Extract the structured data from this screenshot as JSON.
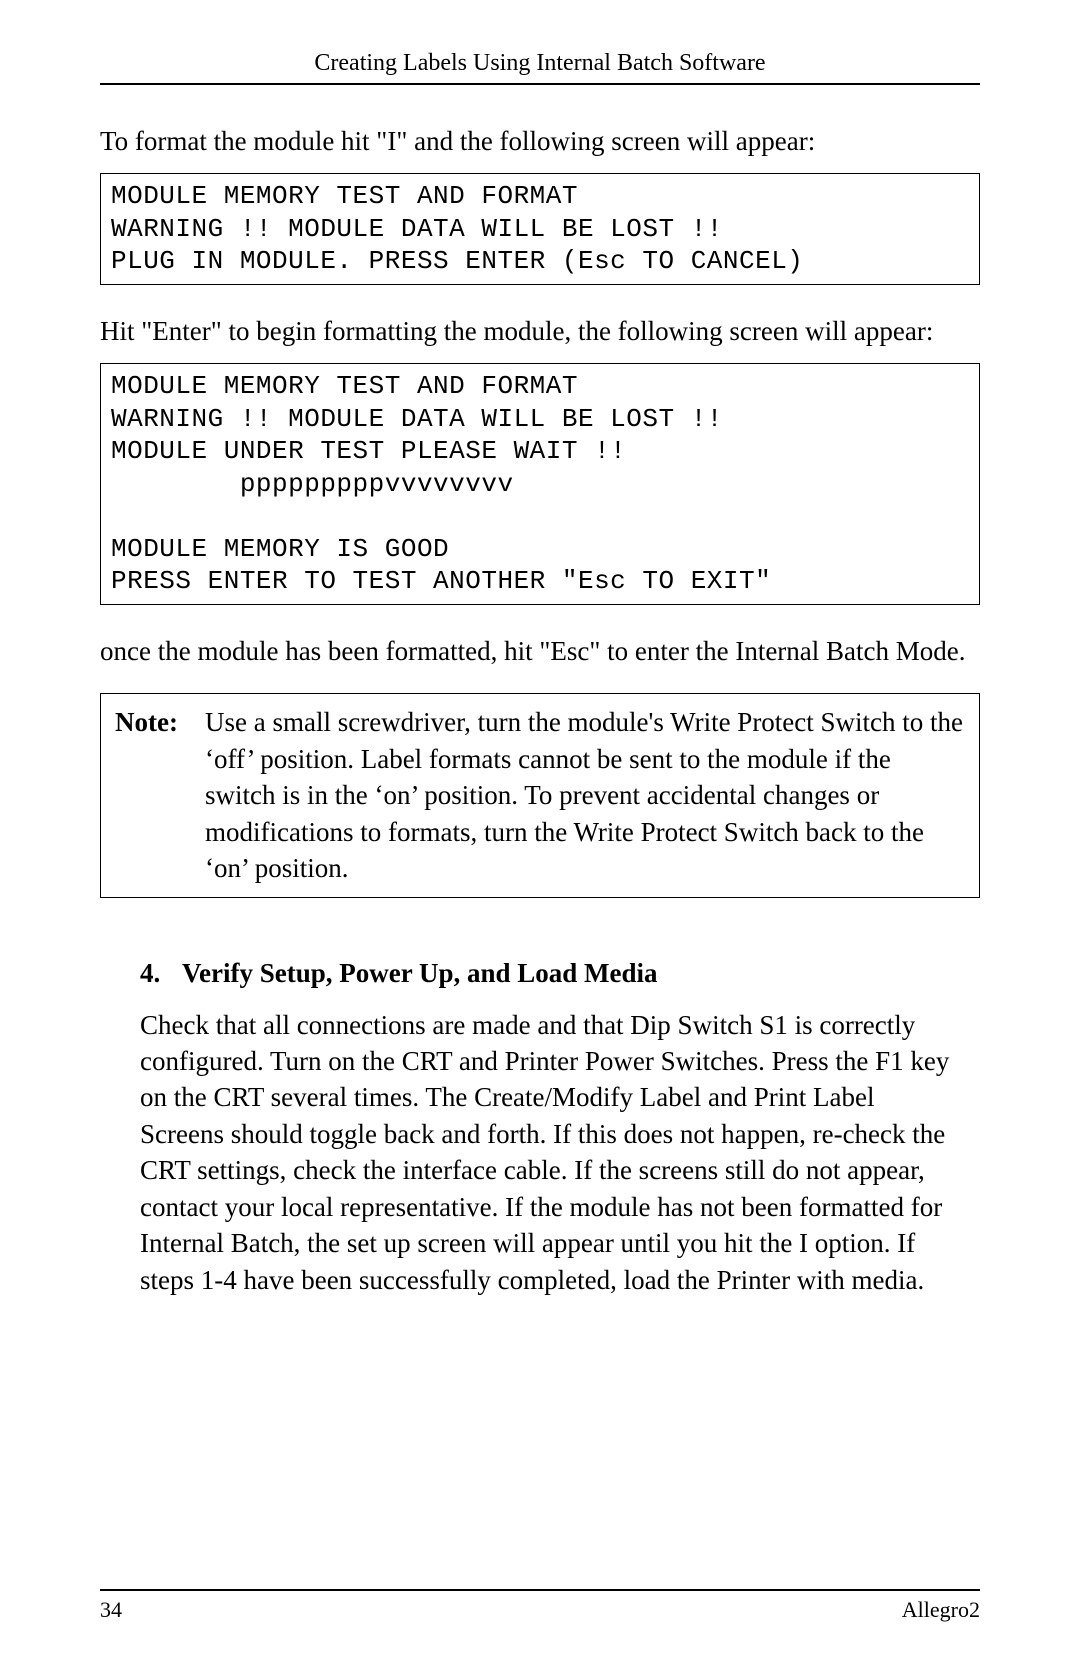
{
  "header_title": "Creating Labels Using Internal Batch Software",
  "para1": "To format the module hit \"I\" and the following screen will appear:",
  "code1_line1": "MODULE MEMORY TEST AND FORMAT",
  "code1_line2": "WARNING !! MODULE DATA WILL BE LOST !!",
  "code1_line3": "PLUG IN MODULE. PRESS ENTER (Esc TO CANCEL)",
  "para2": "Hit \"Enter\" to begin formatting the module,  the following screen will appear:",
  "code2_line1": "MODULE MEMORY TEST AND FORMAT",
  "code2_line2": "WARNING !! MODULE DATA WILL BE LOST !!",
  "code2_line3": "MODULE UNDER TEST PLEASE WAIT !!",
  "code2_line4": "        pppppppppvvvvvvvv",
  "code2_line5": "",
  "code2_line6": "MODULE MEMORY IS GOOD",
  "code2_line7": "PRESS ENTER TO TEST ANOTHER \"Esc TO EXIT\"",
  "para3": "once the module has been formatted, hit \"Esc\" to enter the Internal Batch Mode.",
  "note_label": "Note:",
  "note_body": "Use a small screwdriver,  turn the module's Write Protect Switch to the ‘off’ position. Label formats cannot be sent to the module if the switch is in the ‘on’ position. To prevent accidental changes or modifications to formats, turn the Write Protect Switch back to the ‘on’ position.",
  "section_num": "4.",
  "section_title": "Verify Setup, Power Up, and Load Media",
  "section_body": "Check that all connections are made and that Dip Switch S1 is correctly configured. Turn on the CRT and Printer Power Switches. Press the F1 key on the CRT several times. The Create/Modify Label and Print Label Screens should toggle back and forth. If this does not happen, re-check the CRT settings, check the interface cable. If the screens still do not appear, contact your  local representative. If the module has not been formatted for Internal Batch, the set up screen will appear until you hit the I option. If steps 1-4 have been successfully completed, load the Printer with media.",
  "page_number": "34",
  "footer_right": "Allegro2"
}
